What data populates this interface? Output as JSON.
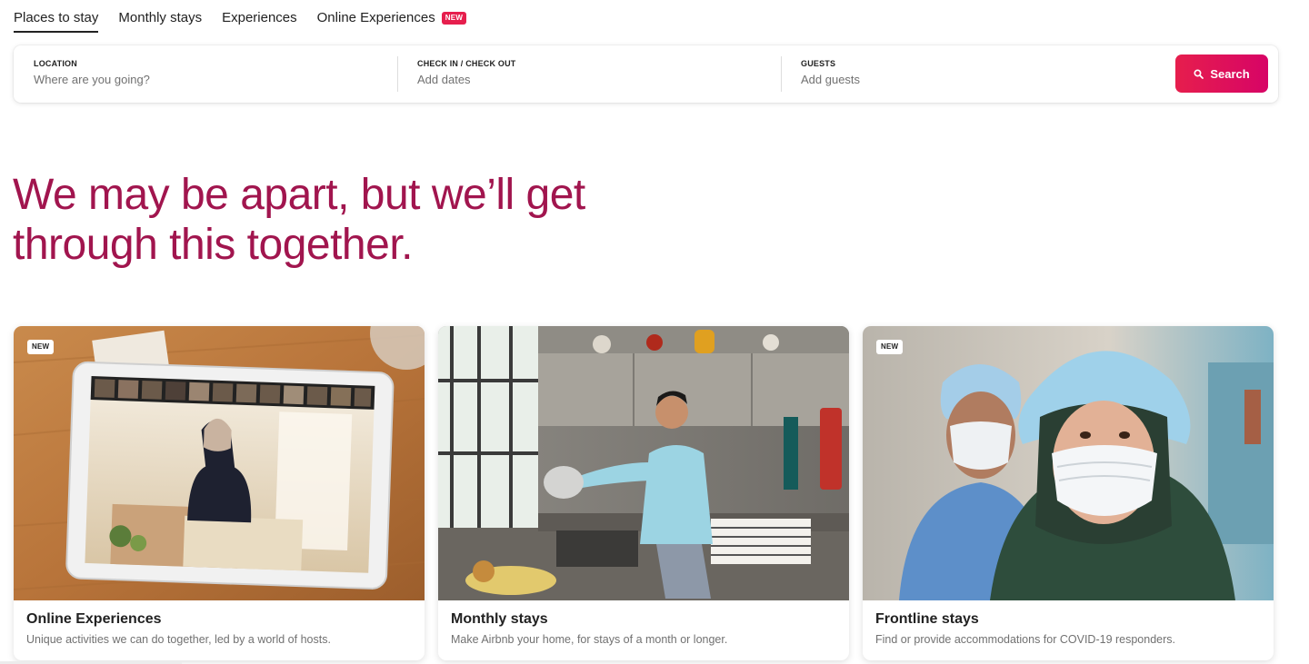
{
  "tabs": [
    {
      "label": "Places to stay",
      "active": true
    },
    {
      "label": "Monthly stays",
      "active": false
    },
    {
      "label": "Experiences",
      "active": false
    },
    {
      "label": "Online Experiences",
      "active": false,
      "badge": "NEW"
    }
  ],
  "search": {
    "location": {
      "label": "LOCATION",
      "placeholder": "Where are you going?"
    },
    "dates": {
      "label": "CHECK IN / CHECK OUT",
      "placeholder": "Add dates"
    },
    "guests": {
      "label": "GUESTS",
      "placeholder": "Add guests"
    },
    "button_label": "Search",
    "button_icon": "search-icon"
  },
  "headline": "We may be apart, but we’ll get through this together.",
  "cards": [
    {
      "badge": "NEW",
      "title": "Online Experiences",
      "description": "Unique activities we can do together, led by a world of hosts.",
      "image": "tablet-video-call-photo"
    },
    {
      "title": "Monthly stays",
      "description": "Make Airbnb your home, for stays of a month or longer.",
      "image": "man-in-kitchen-photo"
    },
    {
      "badge": "NEW",
      "title": "Frontline stays",
      "description": "Find or provide accommodations for COVID-19 responders.",
      "image": "medical-workers-photo"
    }
  ],
  "colors": {
    "brand": "#e61e4d",
    "headline": "#a1154e",
    "text": "#222222",
    "muted": "#717171"
  }
}
